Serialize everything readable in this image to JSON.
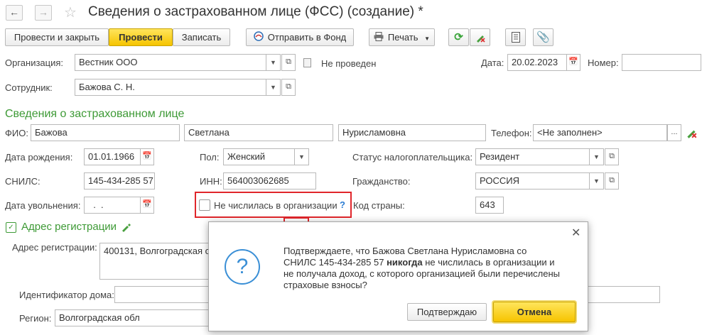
{
  "window": {
    "title": "Сведения о застрахованном лице (ФСС) (создание) *"
  },
  "toolbar": {
    "post_close_label": "Провести и закрыть",
    "post_label": "Провести",
    "save_label": "Записать",
    "send_label": "Отправить в Фонд",
    "print_label": "Печать"
  },
  "header": {
    "org_label": "Организация:",
    "org_value": "Вестник ООО",
    "status_text": "Не проведен",
    "date_label": "Дата:",
    "date_value": "20.02.2023",
    "number_label": "Номер:",
    "number_value": "",
    "employee_label": "Сотрудник:",
    "employee_value": "Бажова С. Н."
  },
  "insured": {
    "section_title": "Сведения о застрахованном лице",
    "fio_label": "ФИО:",
    "last_name": "Бажова",
    "first_name": "Светлана",
    "middle_name": "Нурисламовна",
    "phone_label": "Телефон:",
    "phone_value": "<Не заполнен>",
    "birth_label": "Дата рождения:",
    "birth_value": "01.01.1966",
    "gender_label": "Пол:",
    "gender_value": "Женский",
    "tax_status_label": "Статус налогоплательщика:",
    "tax_status_value": "Резидент",
    "snils_label": "СНИЛС:",
    "snils_value": "145-434-285 57",
    "inn_label": "ИНН:",
    "inn_value": "564003062685",
    "citizenship_label": "Гражданство:",
    "citizenship_value": "РОССИЯ",
    "dismissal_label": "Дата увольнения:",
    "dismissal_value": "  .  .",
    "not_listed_label": "Не числилась в организации",
    "help_mark": "?",
    "country_code_label": "Код страны:",
    "country_code_value": "643"
  },
  "address": {
    "section_title": "Адрес регистрации",
    "reg_label": "Адрес регистрации:",
    "reg_value": "400131, Волгоградская о",
    "house_id_label": "Идентификатор дома:",
    "region_label": "Регион:",
    "region_value": "Волгоградская обл"
  },
  "dialog": {
    "text_before": "Подтверждаете, что Бажова Светлана Нурисламовна со СНИЛС 145-434-285 57 ",
    "text_bold": "никогда",
    "text_after": " не числилась в организации и не получала доход, с которого организацией были перечислены страховые взносы?",
    "confirm_label": "Подтверждаю",
    "cancel_label": "Отмена"
  },
  "colors": {
    "accent_yellow": "#f6c400",
    "section_green": "#3e9a36",
    "highlight_red": "#e0262b",
    "info_blue": "#3a8fd6"
  }
}
